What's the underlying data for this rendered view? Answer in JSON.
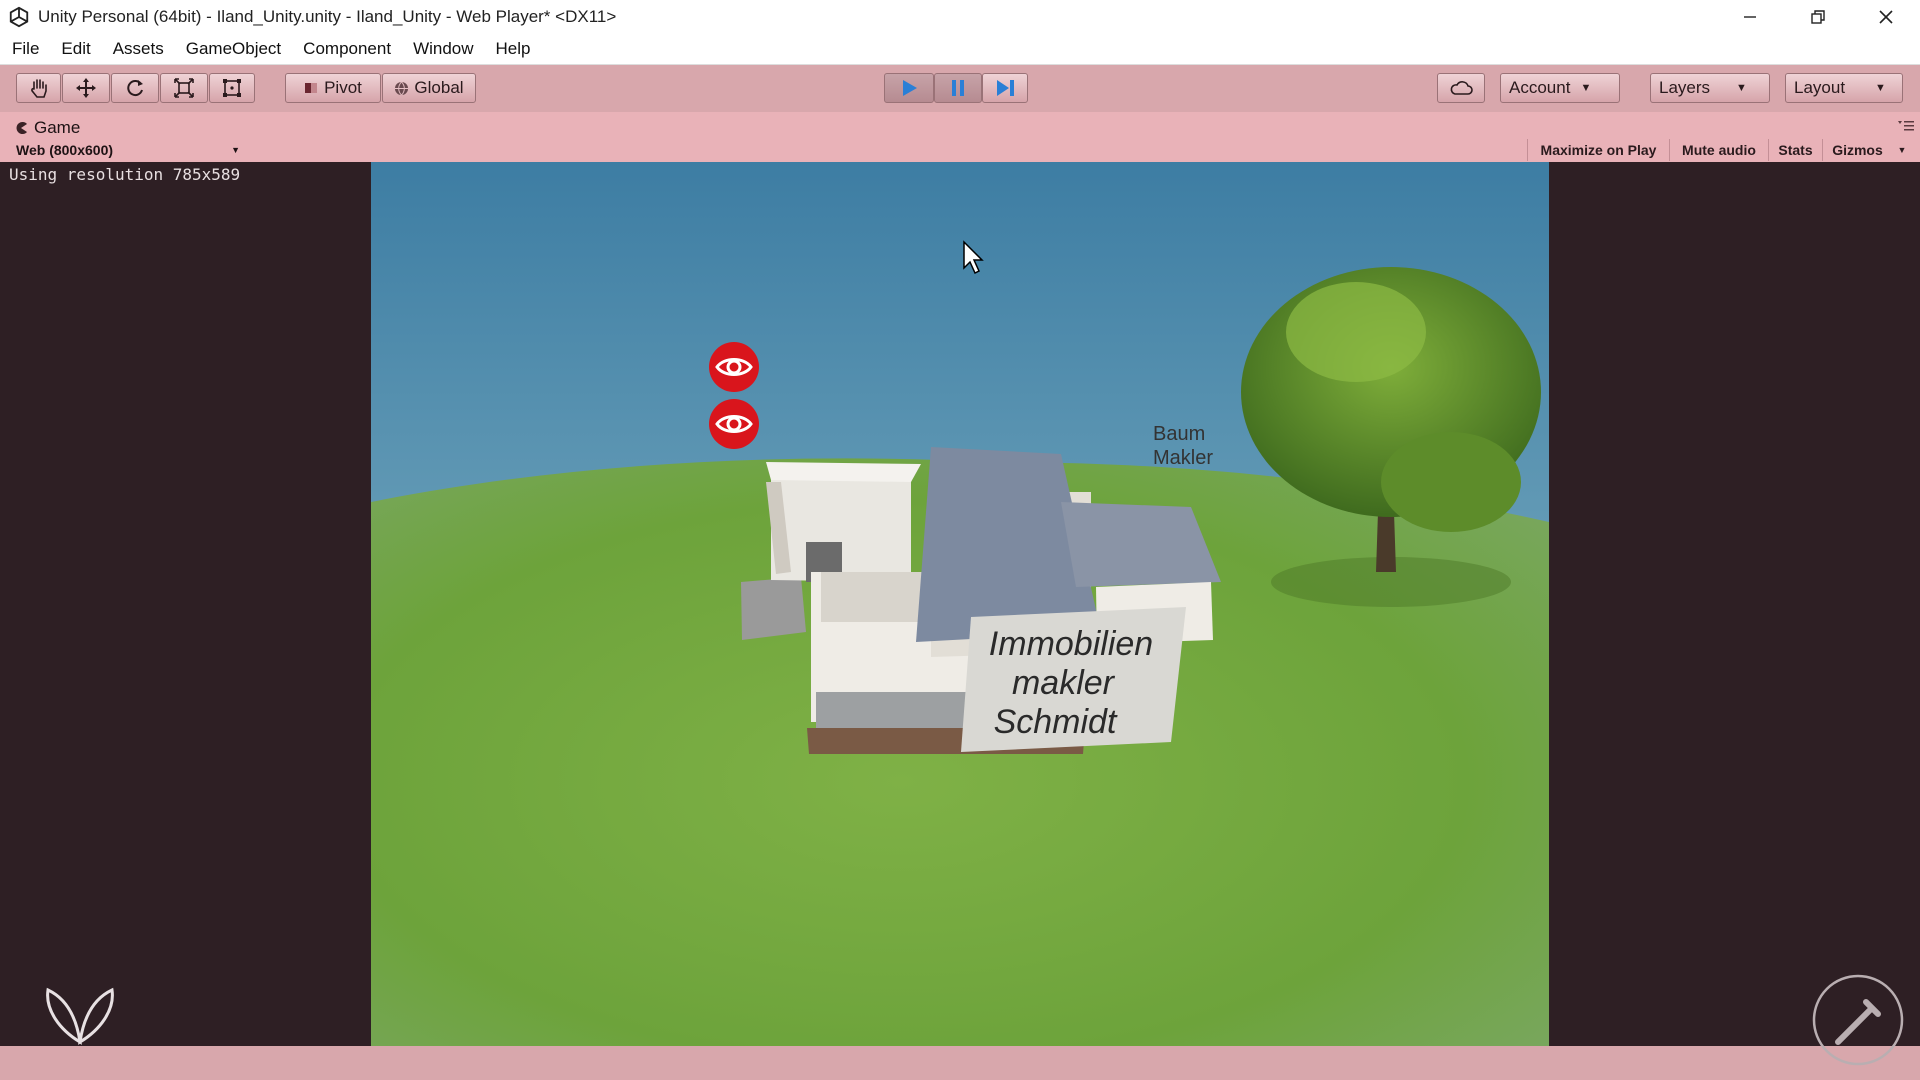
{
  "window": {
    "title": "Unity Personal (64bit) - Iland_Unity.unity - Iland_Unity - Web Player* <DX11>",
    "controls": [
      "minimize-icon",
      "restore-icon",
      "close-icon"
    ]
  },
  "menu": [
    "File",
    "Edit",
    "Assets",
    "GameObject",
    "Component",
    "Window",
    "Help"
  ],
  "toolbar": {
    "tools": [
      "hand-tool-icon",
      "move-tool-icon",
      "rotate-tool-icon",
      "scale-tool-icon",
      "rect-tool-icon"
    ],
    "pivot_label": "Pivot",
    "global_label": "Global",
    "play": {
      "play_active": true,
      "pause_active": true
    },
    "account_label": "Account",
    "layers_label": "Layers",
    "layout_label": "Layout"
  },
  "game_panel": {
    "tab_label": "Game",
    "resolution_option": "Web (800x600)",
    "toggles": [
      "Maximize on Play",
      "Mute audio",
      "Stats",
      "Gizmos"
    ],
    "resolution_text": "Using resolution 785x589"
  },
  "scene": {
    "sign_text": [
      "Immobilien",
      "makler",
      "Schmidt"
    ],
    "floating_label": [
      "Baum",
      "Makler"
    ],
    "hotspot_icons": [
      "eye-icon",
      "eye-icon"
    ]
  },
  "colors": {
    "toolbar_tint": "#d8a7ac",
    "panel_header": "#e9b2b8",
    "play_blue": "#2a7fd6",
    "hotspot_red": "#d9151c",
    "sky_top": "#3d7da3",
    "grass": "#6da33b"
  }
}
